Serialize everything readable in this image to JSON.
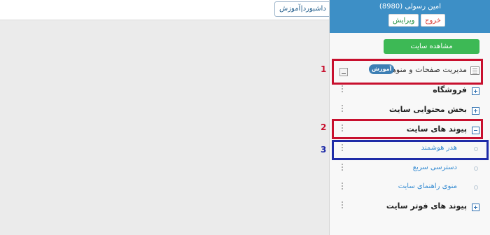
{
  "topbar": {
    "tab_label": "داشبورد|آموزش"
  },
  "user": {
    "name": "امین رسولی (8980)",
    "edit_label": "ویرایش",
    "logout_label": "خروج"
  },
  "view_site_label": "مشاهده سایت",
  "menu": {
    "management": {
      "label": "مدیریت صفحات و منوها",
      "badge": "آموزش"
    },
    "items": [
      {
        "label": "فروشگاه"
      },
      {
        "label": "بخش محتوایی سایت"
      },
      {
        "label": "پیوند های سایت"
      }
    ],
    "sub_items": [
      {
        "label": "هدر هوشمند"
      },
      {
        "label": "دسترسی سریع"
      },
      {
        "label": "منوی راهنمای سایت"
      }
    ],
    "footer_item": {
      "label": "پیوند های فوتر سایت"
    }
  },
  "annotations": [
    "1",
    "2",
    "3"
  ],
  "colors": {
    "header": "#3d8fc6",
    "site_button": "#3db955",
    "highlight_red": "#c8102e",
    "highlight_blue": "#1f2ca8"
  }
}
